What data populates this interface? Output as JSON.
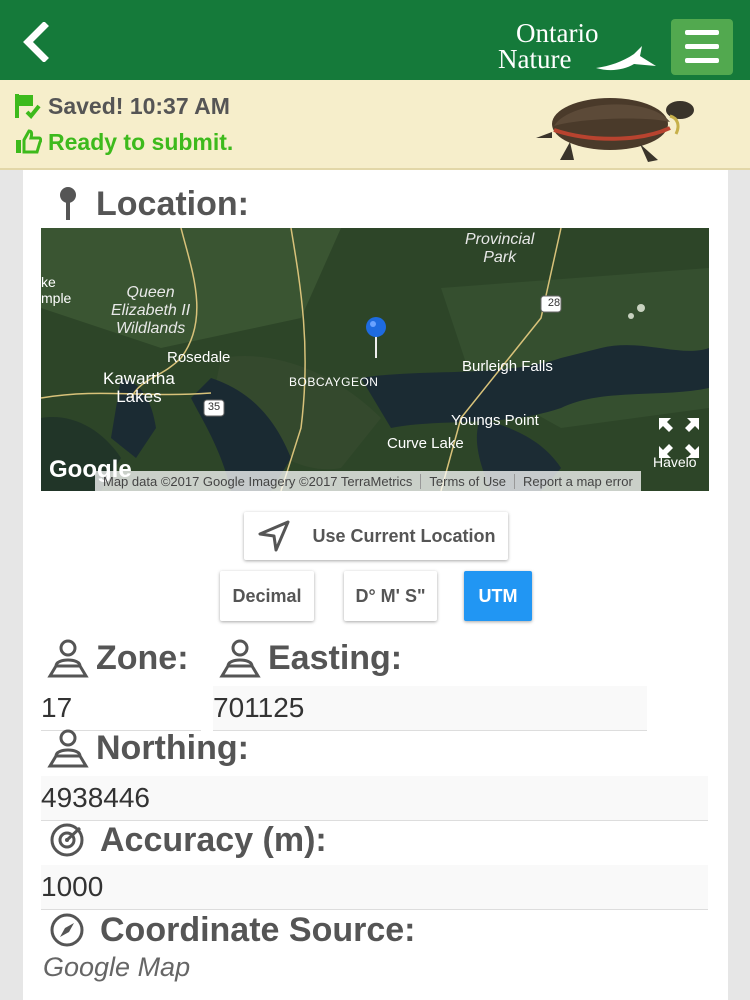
{
  "header": {
    "back_icon": "back-chevron-icon",
    "logo_line1": "Ontario",
    "logo_line2": "Nature",
    "menu_icon": "hamburger-menu-icon",
    "color": "#157a3a"
  },
  "status": {
    "saved_text": "Saved! 10:37 AM",
    "ready_text": "Ready to submit.",
    "saved_icon": "saved-flag-icon",
    "ready_icon": "thumbs-up-icon"
  },
  "location": {
    "label": "Location:",
    "icon": "map-pin-icon"
  },
  "map": {
    "labels": {
      "provincial_park": "Provincial\nPark",
      "queen_elizabeth": "Queen\nElizabeth II\nWildlands",
      "rosedale": "Rosedale",
      "kawartha": "Kawartha\nLakes",
      "bobcaygeon": "BOBCAYGEON",
      "burleigh": "Burleigh Falls",
      "youngs": "Youngs Point",
      "curve": "Curve Lake",
      "ke_mple": "ke\nmple",
      "havelock": "Havelo",
      "route28": "28",
      "route35": "35",
      "google": "Google"
    },
    "footer": {
      "data": "Map data ©2017 Google Imagery ©2017 TerraMetrics",
      "terms": "Terms of Use",
      "report": "Report a map error"
    },
    "expand_icon": "fullscreen-expand-icon",
    "marker_icon": "location-marker-icon"
  },
  "controls": {
    "use_current": "Use Current Location",
    "use_current_icon": "navigation-arrow-icon",
    "formats": [
      "Decimal",
      "D° M' S\"",
      "UTM"
    ],
    "active_format": "UTM",
    "active_color": "#2196f3"
  },
  "fields": {
    "zone_label": "Zone:",
    "zone_value": "17",
    "easting_label": "Easting:",
    "easting_value": "701125",
    "northing_label": "Northing:",
    "northing_value": "4938446",
    "accuracy_label": "Accuracy (m):",
    "accuracy_value": "1000",
    "source_label": "Coordinate Source:",
    "source_value": "Google Map",
    "coord_icon": "user-location-icon",
    "accuracy_icon": "target-icon",
    "source_icon": "compass-icon"
  }
}
